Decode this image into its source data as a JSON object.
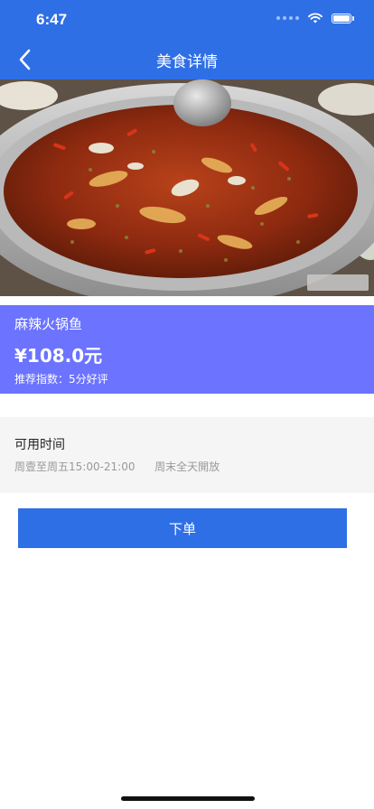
{
  "status_bar": {
    "time": "6:47"
  },
  "nav": {
    "title": "美食详情"
  },
  "dish": {
    "name": "麻辣火锅鱼",
    "price": "¥108.0元",
    "rating": "推荐指数：5分好评"
  },
  "availability": {
    "title": "可用时间",
    "weekday": "周壹至周五15:00-21:00",
    "weekend": "周末全天開放"
  },
  "actions": {
    "order_label": "下单"
  },
  "colors": {
    "primary": "#2f6fe6",
    "info_bg": "#6b73ff",
    "card_bg": "#f5f5f5",
    "muted_text": "#999999"
  }
}
